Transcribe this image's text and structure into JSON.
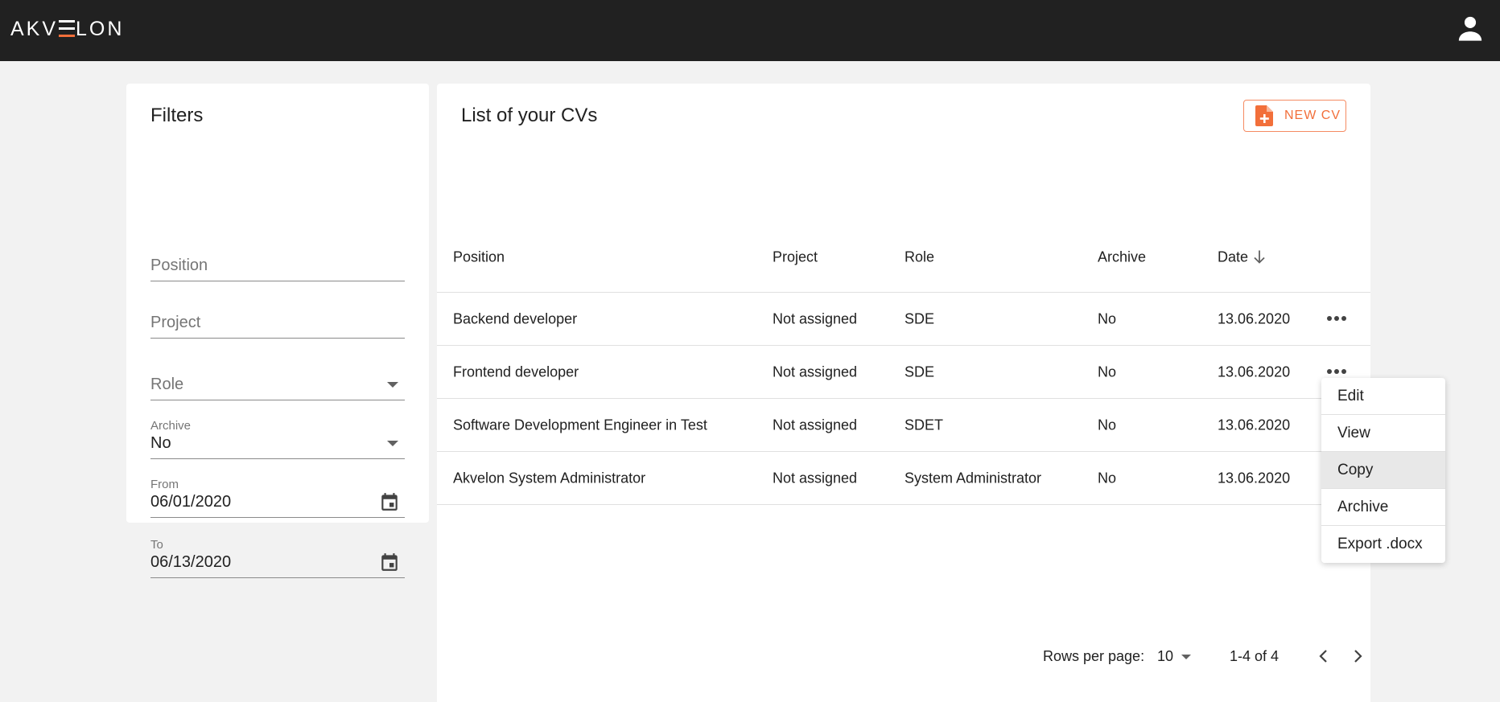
{
  "header": {
    "logo_text": "AKVELON",
    "logo_accent_color": "#f26f3a",
    "user_icon": "user-icon"
  },
  "filters": {
    "title": "Filters",
    "position_placeholder": "Position",
    "project_placeholder": "Project",
    "role_placeholder": "Role",
    "archive_label": "Archive",
    "archive_value": "No",
    "from_label": "From",
    "from_value": "06/01/2020",
    "to_label": "To",
    "to_value": "06/13/2020"
  },
  "cvs": {
    "title": "List of your CVs",
    "new_cv_label": "NEW CV",
    "columns": {
      "position": "Position",
      "project": "Project",
      "role": "Role",
      "archive": "Archive",
      "date": "Date"
    },
    "rows": [
      {
        "position": "Backend developer",
        "project": "Not assigned",
        "role": "SDE",
        "archive": "No",
        "date": "13.06.2020"
      },
      {
        "position": "Frontend developer",
        "project": "Not assigned",
        "role": "SDE",
        "archive": "No",
        "date": "13.06.2020"
      },
      {
        "position": "Software Development Engineer in Test",
        "project": "Not assigned",
        "role": "SDET",
        "archive": "No",
        "date": "13.06.2020"
      },
      {
        "position": "Akvelon System Administrator",
        "project": "Not assigned",
        "role": "System Administrator",
        "archive": "No",
        "date": "13.06.2020"
      }
    ]
  },
  "context_menu": {
    "items": [
      "Edit",
      "View",
      "Copy",
      "Archive",
      "Export .docx"
    ],
    "highlighted": "Copy"
  },
  "pagination": {
    "rows_per_page_label": "Rows per page:",
    "rows_per_page_value": "10",
    "range": "1-4 of 4"
  }
}
